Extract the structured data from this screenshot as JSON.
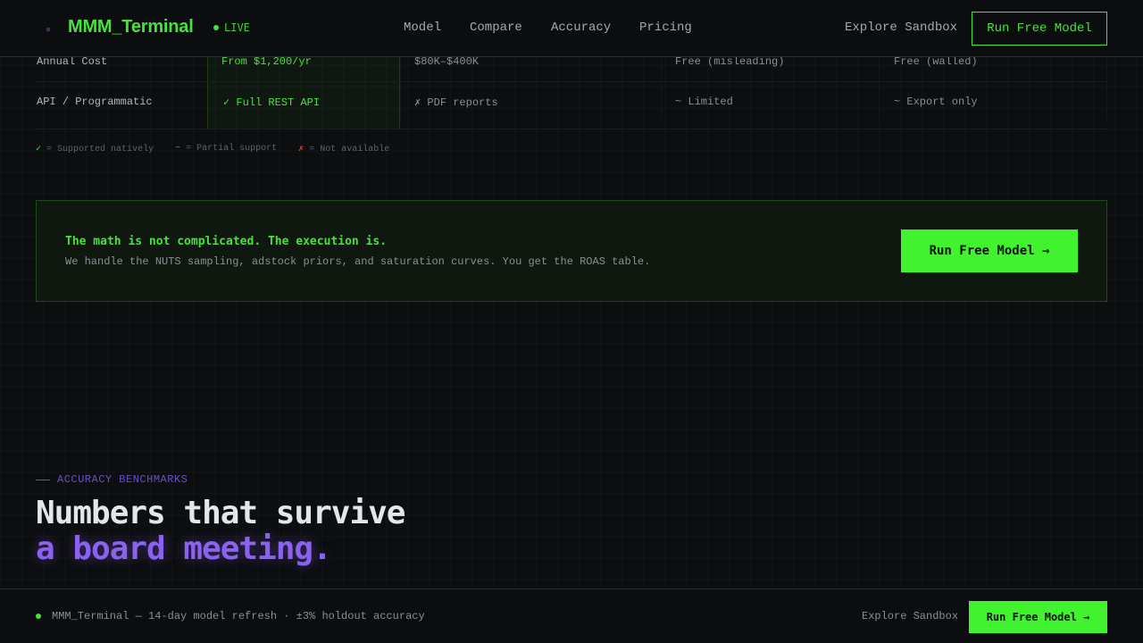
{
  "header": {
    "logo_icon": "terminal-glyph-icon",
    "logo_glyph": "▪",
    "brand": "MMM_Terminal",
    "live_label": "LIVE",
    "nav": [
      "Model",
      "Compare",
      "Accuracy",
      "Pricing"
    ],
    "explore_label": "Explore Sandbox",
    "cta_label": "Run Free Model"
  },
  "comparison_table": {
    "rows": [
      {
        "label": "Annual Cost",
        "cells": [
          "From $1,200/yr",
          "$80K–$400K",
          "Free (misleading)",
          "Free (walled)"
        ]
      },
      {
        "label": "API / Programmatic",
        "cells": [
          "✓ Full REST API",
          "✗ PDF reports",
          "~ Limited",
          "~ Export only"
        ]
      }
    ]
  },
  "legend": {
    "supported_mark": "✓",
    "supported_text": "= Supported natively",
    "partial_mark": "~",
    "partial_text": "= Partial support",
    "none_mark": "✗",
    "none_text": "= Not available"
  },
  "cta_panel": {
    "title": "The math is not complicated. The execution is.",
    "subtitle": "We handle the NUTS sampling, adstock priors, and saturation curves. You get the ROAS table.",
    "button": "Run Free Model →"
  },
  "accuracy": {
    "eyebrow": "ACCURACY BENCHMARKS",
    "headline_line1": "Numbers that survive",
    "headline_line2": "a board meeting."
  },
  "bottom_bar": {
    "text": "MMM_Terminal — 14-day model refresh · ±3% holdout accuracy",
    "explore_label": "Explore Sandbox",
    "button": "Run Free Model →"
  },
  "colors": {
    "accent_green": "#41f32f",
    "accent_purple": "#8b62f0",
    "background": "#0c0e10",
    "negative_red": "#e0433b"
  }
}
